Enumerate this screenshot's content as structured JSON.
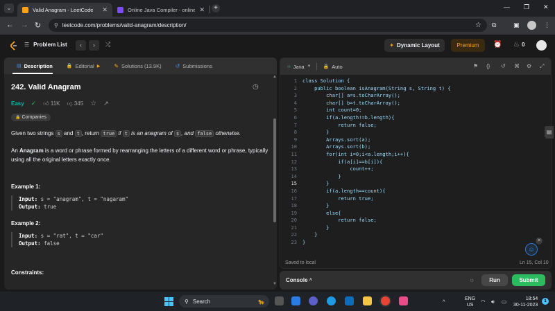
{
  "browser": {
    "tabs": [
      {
        "title": "Valid Anagram - LeetCode",
        "favicon_color": "#ffa116"
      },
      {
        "title": "Online Java Compiler - online e",
        "favicon_color": "#7c4dff"
      }
    ],
    "url": "leetcode.com/problems/valid-anagram/description/"
  },
  "nav": {
    "problem_list": "Problem List",
    "dynamic_layout": "Dynamic Layout",
    "premium": "Premium",
    "streak": "0"
  },
  "left_tabs": {
    "description": "Description",
    "editorial": "Editorial",
    "solutions": "Solutions (13.9K)",
    "submissions": "Submissions"
  },
  "problem": {
    "title": "242. Valid Anagram",
    "difficulty": "Easy",
    "likes": "11K",
    "dislikes": "345",
    "companies": "Companies",
    "p1": {
      "a": "Given two strings ",
      "s": "s",
      "b": " and ",
      "t": "t",
      "c": ", return ",
      "true": "true",
      "d": " if ",
      "t2": "t",
      "e": " is an anagram of ",
      "s2": "s",
      "f": ", and ",
      "false": "false",
      "g": " otherwise."
    },
    "p2": {
      "a": "An ",
      "anagram": "Anagram",
      "b": " is a word or phrase formed by rearranging the letters of a different word or phrase, typically using all the original letters exactly once."
    },
    "examples": [
      {
        "heading": "Example 1:",
        "input_label": "Input:",
        "input": " s = \"anagram\", t = \"nagaram\"",
        "output_label": "Output:",
        "output": " true"
      },
      {
        "heading": "Example 2:",
        "input_label": "Input:",
        "input": " s = \"rat\", t = \"car\"",
        "output_label": "Output:",
        "output": " false"
      }
    ],
    "constraints": "Constraints:"
  },
  "editor": {
    "language": "Java",
    "mode": "Auto",
    "lines": [
      {
        "n": "1",
        "text": "class Solution {"
      },
      {
        "n": "2",
        "text": "    public boolean isAnagram(String s, String t) {"
      },
      {
        "n": "3",
        "text": "        char[] a=s.toCharArray();"
      },
      {
        "n": "4",
        "text": "        char[] b=t.toCharArray();"
      },
      {
        "n": "5",
        "text": "        int count=0;"
      },
      {
        "n": "6",
        "text": "        if(a.length!=b.length){"
      },
      {
        "n": "7",
        "text": "            return false;"
      },
      {
        "n": "8",
        "text": "        }"
      },
      {
        "n": "9",
        "text": "        Arrays.sort(a);"
      },
      {
        "n": "10",
        "text": "        Arrays.sort(b);"
      },
      {
        "n": "11",
        "text": "        for(int i=0;i<a.length;i++){"
      },
      {
        "n": "12",
        "text": "            if(a[i]==b[i]){"
      },
      {
        "n": "13",
        "text": "                count++;"
      },
      {
        "n": "14",
        "text": "            }"
      },
      {
        "n": "15",
        "text": "        }"
      },
      {
        "n": "16",
        "text": "        if(a.length==count){"
      },
      {
        "n": "17",
        "text": "            return true;"
      },
      {
        "n": "18",
        "text": "        }"
      },
      {
        "n": "19",
        "text": "        else{"
      },
      {
        "n": "20",
        "text": "            return false;"
      },
      {
        "n": "21",
        "text": "        }"
      },
      {
        "n": "22",
        "text": "    }"
      },
      {
        "n": "23",
        "text": "}"
      }
    ],
    "current_line": "15",
    "saved": "Saved to local",
    "position": "Ln 15, Col 10"
  },
  "console": {
    "label": "Console",
    "run": "Run",
    "submit": "Submit"
  },
  "taskbar": {
    "search": "Search",
    "lang_top": "ENG",
    "lang_bottom": "US",
    "time": "18:54",
    "date": "30-11-2023",
    "notif": "1"
  },
  "colors": {
    "accent_orange": "#ffa116",
    "easy_teal": "#00b8a3",
    "submit_green": "#2cbb5d"
  }
}
